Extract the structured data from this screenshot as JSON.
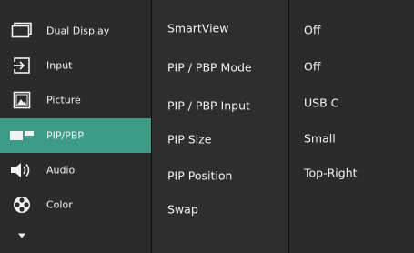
{
  "main_menu": {
    "items": [
      {
        "label": "Dual Display",
        "icon": "dual-display-icon"
      },
      {
        "label": "Input",
        "icon": "input-icon"
      },
      {
        "label": "Picture",
        "icon": "picture-icon"
      },
      {
        "label": "PIP/PBP",
        "icon": "pip-pbp-icon",
        "active": true
      },
      {
        "label": "Audio",
        "icon": "audio-icon"
      },
      {
        "label": "Color",
        "icon": "color-icon"
      }
    ],
    "more_icon": "chevron-down-icon"
  },
  "submenu": {
    "items": [
      {
        "label": "SmartView"
      },
      {
        "label": "PIP / PBP Mode"
      },
      {
        "label": "PIP / PBP Input"
      },
      {
        "label": "PIP Size"
      },
      {
        "label": "PIP Position"
      },
      {
        "label": "Swap"
      }
    ]
  },
  "values": {
    "items": [
      {
        "label": "Off"
      },
      {
        "label": "Off"
      },
      {
        "label": "USB C"
      },
      {
        "label": "Small"
      },
      {
        "label": "Top-Right"
      }
    ]
  },
  "colors": {
    "background": "#2b2b2b",
    "active_item": "#3b9b86",
    "text": "#f2f2f2",
    "divider": "#0d0d0d"
  }
}
